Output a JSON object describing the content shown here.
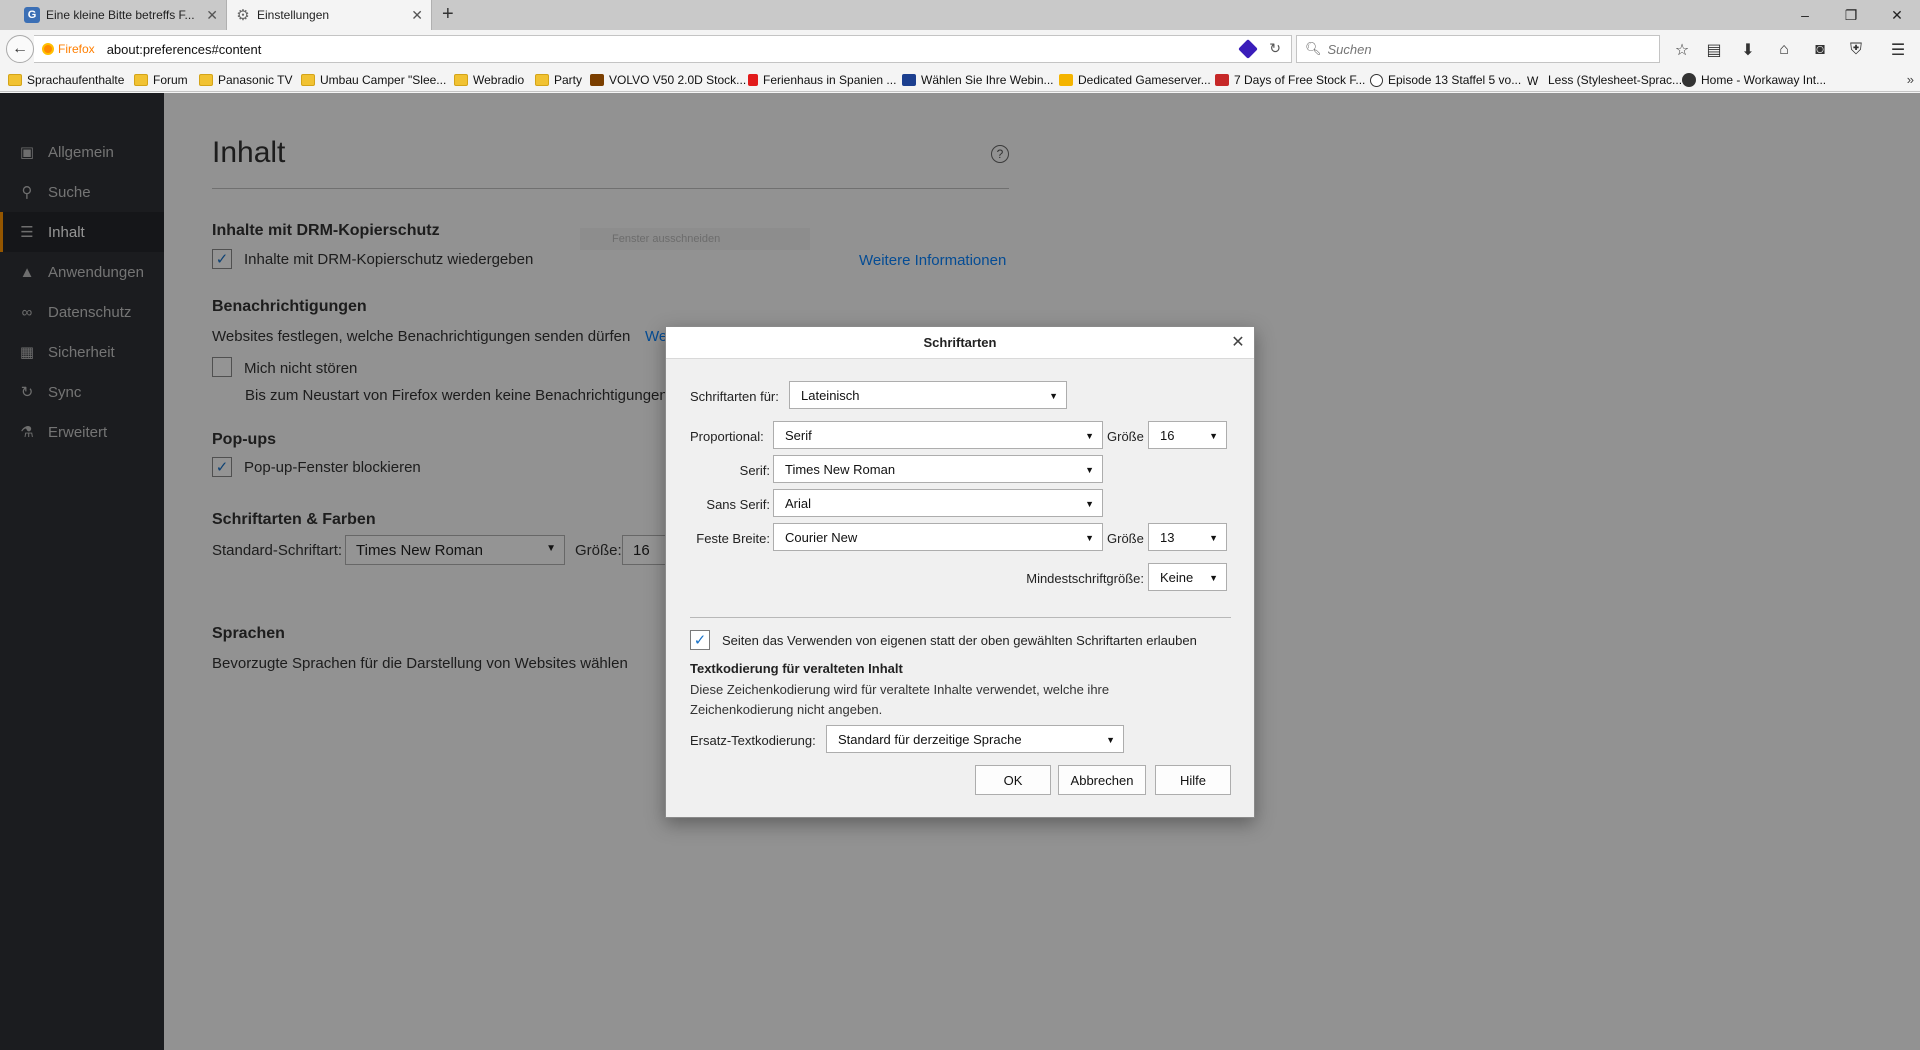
{
  "tabs": [
    {
      "title": "Eine kleine Bitte betreffs F...",
      "icon": "G"
    },
    {
      "title": "Einstellungen",
      "icon": "⚙"
    }
  ],
  "new_tab": "+",
  "window_controls": [
    "–",
    "❐",
    "✕"
  ],
  "navbar": {
    "identity": "Firefox",
    "url": "about:preferences#content",
    "search_placeholder": "Suchen"
  },
  "bookmarks": [
    {
      "label": "Sprachaufenthalte",
      "kind": "folder"
    },
    {
      "label": "Forum",
      "kind": "folder"
    },
    {
      "label": "Panasonic TV",
      "kind": "folder"
    },
    {
      "label": "Umbau Camper \"Slee...",
      "kind": "folder"
    },
    {
      "label": "Webradio",
      "kind": "folder"
    },
    {
      "label": "Party",
      "kind": "folder"
    },
    {
      "label": "VOLVO V50 2.0D Stock...",
      "kind": "site"
    },
    {
      "label": "Ferienhaus in Spanien ...",
      "kind": "site"
    },
    {
      "label": "Wählen Sie Ihre Webin...",
      "kind": "site"
    },
    {
      "label": "Dedicated Gameserver...",
      "kind": "site"
    },
    {
      "label": "7 Days of Free Stock F...",
      "kind": "site"
    },
    {
      "label": "Episode 13 Staffel 5 vo...",
      "kind": "site"
    },
    {
      "label": "Less (Stylesheet-Sprac...",
      "kind": "site"
    },
    {
      "label": "Home - Workaway Int...",
      "kind": "site"
    }
  ],
  "sidebar": {
    "items": [
      {
        "label": "Allgemein",
        "icon": "general-icon"
      },
      {
        "label": "Suche",
        "icon": "search-icon"
      },
      {
        "label": "Inhalt",
        "icon": "content-icon",
        "active": true
      },
      {
        "label": "Anwendungen",
        "icon": "applications-icon"
      },
      {
        "label": "Datenschutz",
        "icon": "privacy-mask-icon"
      },
      {
        "label": "Sicherheit",
        "icon": "security-icon"
      },
      {
        "label": "Sync",
        "icon": "sync-icon"
      },
      {
        "label": "Erweitert",
        "icon": "advanced-icon"
      }
    ]
  },
  "page": {
    "title": "Inhalt",
    "help": "?",
    "drm": {
      "heading": "Inhalte mit DRM-Kopierschutz",
      "checkbox_label": "Inhalte mit DRM-Kopierschutz wiedergeben",
      "checked": true,
      "more_info": "Weitere Informationen"
    },
    "snip_hint": "Fenster ausschneiden",
    "notifications": {
      "heading": "Benachrichtigungen",
      "text": "Websites festlegen, welche Benachrichtigungen senden dürfen",
      "link_fragment": "We",
      "dnd_label": "Mich nicht stören",
      "dnd_note": "Bis zum Neustart von Firefox werden keine Benachrichtigungen"
    },
    "popups": {
      "heading": "Pop-ups",
      "checkbox_label": "Pop-up-Fenster blockieren",
      "checked": true
    },
    "fonts": {
      "heading": "Schriftarten & Farben",
      "default_label": "Standard-Schriftart:",
      "default_value": "Times New Roman",
      "size_label": "Größe:",
      "size_value": "16"
    },
    "languages": {
      "heading": "Sprachen",
      "text": "Bevorzugte Sprachen für die Darstellung von Websites wählen"
    }
  },
  "dialog": {
    "title": "Schriftarten",
    "fonts_for_label": "Schriftarten für:",
    "fonts_for_value": "Lateinisch",
    "proportional_label": "Proportional:",
    "proportional_value": "Serif",
    "size_label": "Größe",
    "proportional_size": "16",
    "serif_label": "Serif:",
    "serif_value": "Times New Roman",
    "sans_label": "Sans Serif:",
    "sans_value": "Arial",
    "mono_label": "Feste Breite:",
    "mono_value": "Courier New",
    "mono_size": "13",
    "min_size_label": "Mindestschriftgröße:",
    "min_size_value": "Keine",
    "allow_pages_label": "Seiten das Verwenden von eigenen statt der oben gewählten Schriftarten erlauben",
    "allow_pages_checked": true,
    "encoding_heading": "Textkodierung für veralteten Inhalt",
    "encoding_text": "Diese Zeichenkodierung wird für veraltete Inhalte verwendet, welche ihre Zeichenkodierung nicht angeben.",
    "fallback_label": "Ersatz-Textkodierung:",
    "fallback_value": "Standard für derzeitige Sprache",
    "ok": "OK",
    "cancel": "Abbrechen",
    "help": "Hilfe"
  },
  "colors": {
    "accent": "#ff9500",
    "sidebar_bg": "#2f3136",
    "link": "#0a84ff",
    "checkmark": "#1a73c8"
  }
}
